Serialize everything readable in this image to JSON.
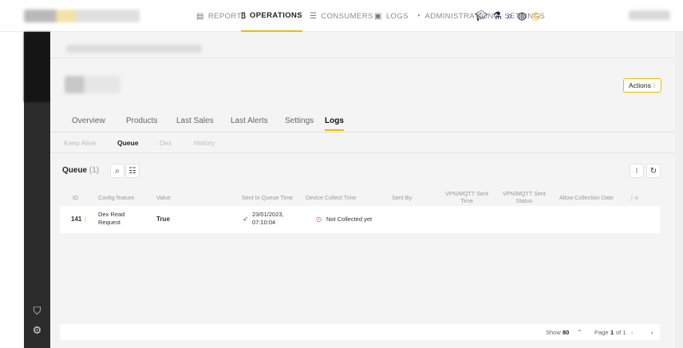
{
  "nav": {
    "items": [
      {
        "label": "REPORTS",
        "icon": "document-icon"
      },
      {
        "label": "OPERATIONS",
        "icon": "clipboard-icon"
      },
      {
        "label": "CONSUMERS",
        "icon": "list-icon"
      },
      {
        "label": "LOGS",
        "icon": "calendar-icon"
      },
      {
        "label": "ADMINISTRATION",
        "icon": "dial-icon"
      },
      {
        "label": "SETTINGS",
        "icon": "gear-icon"
      }
    ],
    "active": "OPERATIONS"
  },
  "header": {
    "actions_label": "Actions"
  },
  "tabs": [
    "Overview",
    "Products",
    "Last Sales",
    "Last Alerts",
    "Settings",
    "Logs"
  ],
  "active_tab": "Logs",
  "subtabs": [
    "Keep Alive",
    "Queue",
    "Dex",
    "History"
  ],
  "active_subtab": "Queue",
  "queue": {
    "title": "Queue",
    "count": "(1)"
  },
  "table": {
    "headers": [
      "ID",
      "Config feature",
      "Value",
      "Sent to Queue Time",
      "Device Collect Time",
      "Sent By",
      "VPN/MQTT Sent Time",
      "VPN/MQTT Sent Status",
      "Allow Collection Date"
    ],
    "rows": [
      {
        "id": "141",
        "config_feature": "Dex Read Request",
        "value": "True",
        "sent_to_queue_date": "23/01/2023,",
        "sent_to_queue_time": "07:10:04",
        "device_collect_time": "Not Collected yet",
        "sent_by": "",
        "vpn_sent_time": "",
        "vpn_sent_status": "",
        "allow_collection_date": ""
      }
    ]
  },
  "footer": {
    "show_label": "Show",
    "show_value": "80",
    "page_label": "Page",
    "page_current": "1",
    "page_of": "of 1"
  },
  "colors": {
    "accent": "#f5b800",
    "sidebar": "#2c2c2c",
    "not_collected": "#e0442d",
    "sent_icon": "#3a6df0"
  }
}
